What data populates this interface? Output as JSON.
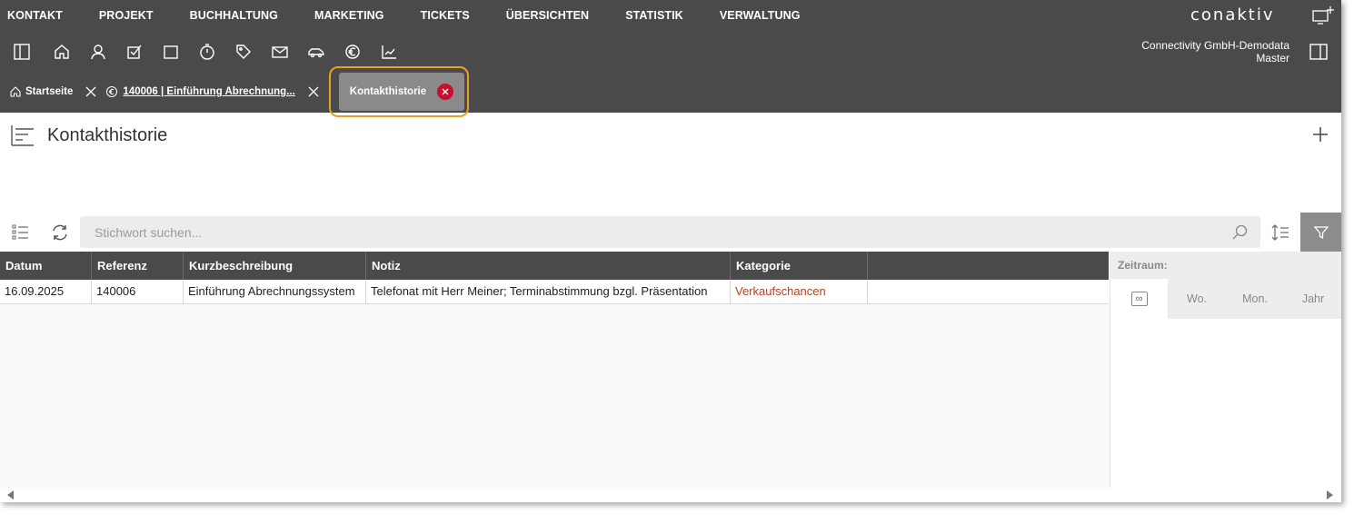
{
  "app": {
    "logo": "conaktiv",
    "company_line1": "Connectivity GmbH-Demodata",
    "company_line2": "Master"
  },
  "topnav": [
    "KONTAKT",
    "PROJEKT",
    "BUCHHALTUNG",
    "MARKETING",
    "TICKETS",
    "ÜBERSICHTEN",
    "STATISTIK",
    "VERWALTUNG"
  ],
  "iconbar": [
    "sidebar-toggle-icon",
    "home-icon",
    "person-icon",
    "checkbox-icon",
    "square-icon",
    "stopwatch-icon",
    "tag-icon",
    "mail-icon",
    "car-icon",
    "euro-icon",
    "chart-icon"
  ],
  "tabs": {
    "home": "Startseite",
    "ref": "140006 | Einführung Abrechnung...",
    "active": "Kontakthistorie"
  },
  "page": {
    "title": "Kontakthistorie"
  },
  "search": {
    "placeholder": "Stichwort suchen..."
  },
  "table": {
    "columns": [
      "Datum",
      "Referenz",
      "Kurzbeschreibung",
      "Notiz",
      "Kategorie"
    ],
    "rows": [
      {
        "datum": "16.09.2025",
        "referenz": "140006",
        "kurzbeschreibung": "Einführung Abrechnungssystem",
        "notiz": "Telefonat mit Herr Meiner; Terminabstimmung bzgl. Präsentation",
        "kategorie": "Verkaufschancen"
      }
    ]
  },
  "zeitraum": {
    "label": "Zeitraum:",
    "infinite": "∞",
    "week": "Wo.",
    "month": "Mon.",
    "year": "Jahr"
  },
  "colors": {
    "header_bg": "#4a4a4a",
    "highlight": "#e8a021",
    "close_red": "#c8102e",
    "category_text": "#b5431e"
  }
}
